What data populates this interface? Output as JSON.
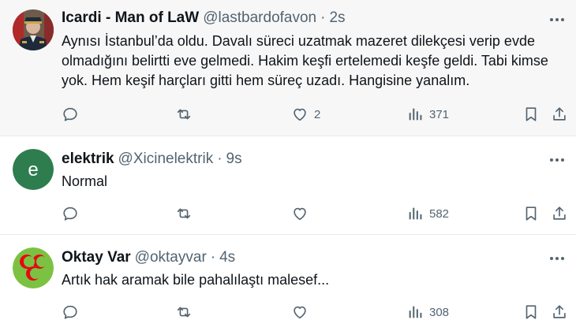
{
  "tweets": [
    {
      "name": "Icardi - Man of LaW",
      "handle": "@lastbardofavon",
      "separator": "·",
      "time": "2s",
      "text": "Aynısı İstanbul’da oldu. Davalı süreci uzatmak mazeret dilekçesi verip evde olmadığını belirtti eve gelmedi. Hakim keşfi ertelemedi keşfe geldi. Tabi kimse yok. Hem keşif harçları gitti hem süreç uzadı. Hangisine yanalım.",
      "avatar_icon": "uniformed-officer-photo",
      "replies": "",
      "reposts": "",
      "likes": "2",
      "views": "371"
    },
    {
      "name": "elektrik",
      "handle": "@Xicinelektrik",
      "separator": "·",
      "time": "9s",
      "text": "Normal",
      "avatar_letter": "e",
      "avatar_color": "#2e7d4f",
      "replies": "",
      "reposts": "",
      "likes": "",
      "views": "582"
    },
    {
      "name": "Oktay Var",
      "handle": "@oktayvar",
      "separator": "·",
      "time": "4s",
      "text": "Artık hak aramak bile pahalılaştı malesef...",
      "avatar_icon": "three-crescents-emblem",
      "avatar_color": "#e30a17",
      "replies": "",
      "reposts": "",
      "likes": "",
      "views": "308"
    }
  ],
  "colors": {
    "text": "#0f1419",
    "secondary": "#536471",
    "divider": "#e6e9ec",
    "highlight_bg": "#f7f7f7"
  }
}
